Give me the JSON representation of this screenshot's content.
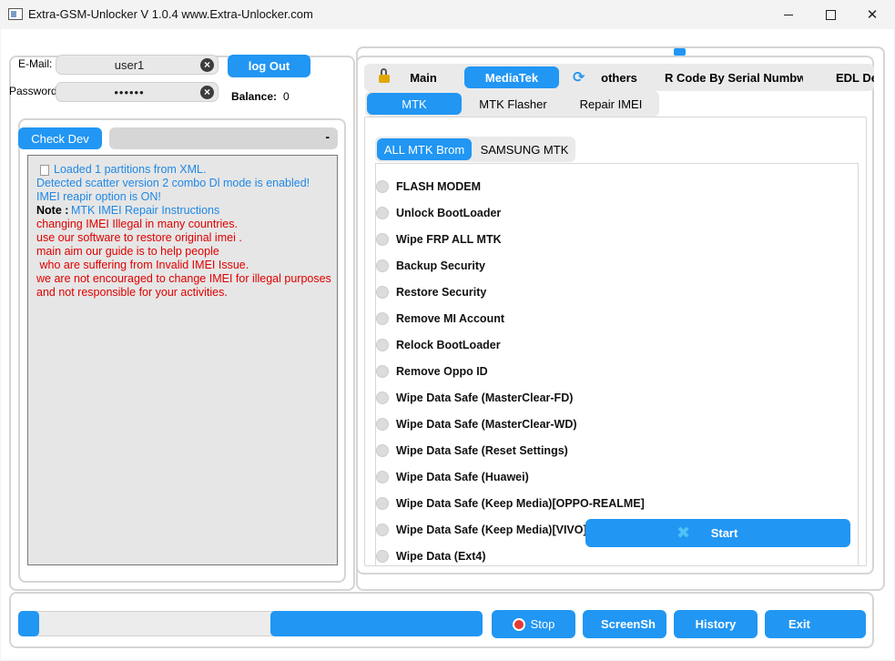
{
  "window": {
    "title": "Extra-GSM-Unlocker V 1.0.4 www.Extra-Unlocker.com"
  },
  "login": {
    "email_label": "E-Mail:",
    "email_value": "user1",
    "password_label": "Password:",
    "password_value": "••••••",
    "logout_label": "log Out",
    "balance_label": "Balance:",
    "balance_value": "0"
  },
  "device": {
    "check_dev_label": "Check Dev",
    "device_field_value": "-"
  },
  "log": {
    "line1": "Loaded 1 partitions from XML.",
    "line2": "Detected scatter version 2 combo Dl mode is enabled!",
    "line3": "IMEI reapir option is ON!",
    "note_label": "Note :",
    "note_link": "MTK IMEI Repair Instructions",
    "warn1": "changing IMEI Illegal in many countries.",
    "warn2": "use our software to restore original imei .",
    "warn3": "main aim our guide is to help people",
    "warn4": " who are suffering from Invalid IMEI Issue.",
    "warn5": "we are not encouraged to change IMEI for illegal purposes",
    "warn6": "and not responsible for your activities.",
    "colors": {
      "info": "#1e88e5",
      "warn": "#e00000"
    }
  },
  "tabs_main": [
    "Main",
    "MediaTek",
    "others",
    "R Code By Serial Numbwe",
    "EDL Dev"
  ],
  "tabs_mtk": [
    "MTK",
    "MTK Flasher",
    "Repair IMEI"
  ],
  "tabs_brom": [
    "ALL MTK Brom",
    "SAMSUNG MTK"
  ],
  "operations": [
    "FLASH MODEM",
    "Unlock BootLoader",
    "Wipe FRP ALL MTK",
    "Backup Security",
    "Restore Security",
    "Remove MI Account",
    "Relock BootLoader",
    "Remove Oppo ID",
    "Wipe Data Safe (MasterClear-FD)",
    "Wipe Data Safe (MasterClear-WD)",
    "Wipe Data Safe (Reset Settings)",
    "Wipe Data Safe (Huawei)",
    "Wipe Data Safe (Keep Media)[OPPO-REALME]",
    "Wipe Data Safe (Keep Media)[VIVO]",
    "Wipe Data (Ext4)"
  ],
  "start_label": "Start",
  "bottom": {
    "stop_label": "Stop",
    "screenshot_label": "ScreenSh",
    "history_label": "History",
    "exit_label": "Exit"
  },
  "colors": {
    "accent": "#2196f3",
    "stop_icon": "#e53935"
  }
}
